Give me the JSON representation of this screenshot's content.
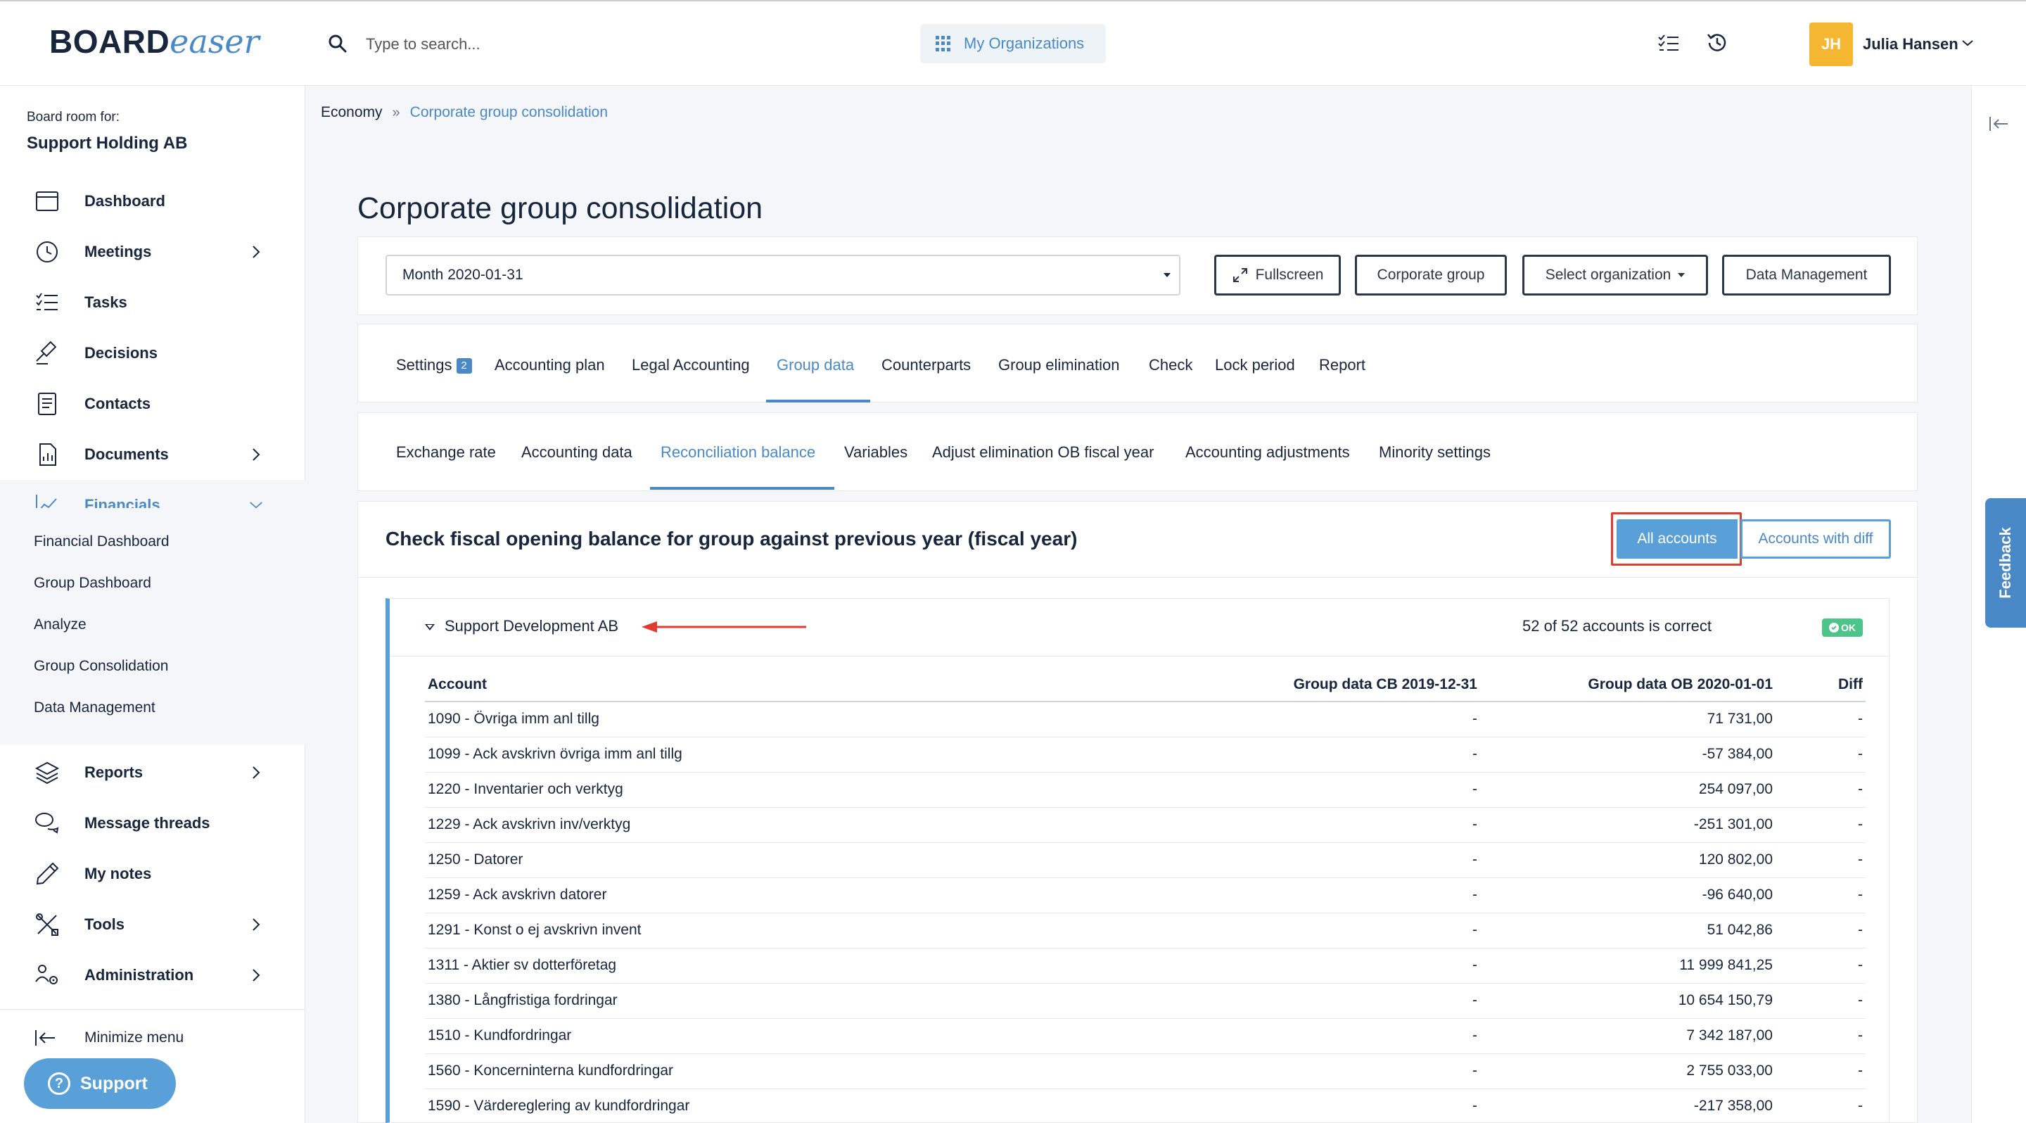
{
  "app": {
    "logo_main": "BOARD",
    "logo_accent": "easer",
    "search_placeholder": "Type to search...",
    "orgs_button": "My Organizations",
    "user_initials": "JH",
    "user_name": "Julia Hansen"
  },
  "sidebar": {
    "board_room_label": "Board room for:",
    "org_name": "Support Holding AB",
    "items": [
      {
        "label": "Dashboard"
      },
      {
        "label": "Meetings"
      },
      {
        "label": "Tasks"
      },
      {
        "label": "Decisions"
      },
      {
        "label": "Contacts"
      },
      {
        "label": "Documents"
      },
      {
        "label": "Financials"
      },
      {
        "label": "Reports"
      },
      {
        "label": "Message threads"
      },
      {
        "label": "My notes"
      },
      {
        "label": "Tools"
      },
      {
        "label": "Administration"
      }
    ],
    "financials_sub": [
      "Financial Dashboard",
      "Group Dashboard",
      "Analyze",
      "Group Consolidation",
      "Data Management"
    ],
    "minimize_label": "Minimize menu",
    "support_label": "Support"
  },
  "breadcrumb": {
    "parent": "Economy",
    "separator": "»",
    "current": "Corporate group consolidation"
  },
  "page": {
    "title": "Corporate group consolidation",
    "period": "Month 2020-01-31",
    "buttons": {
      "fullscreen": "Fullscreen",
      "corporate_group": "Corporate group",
      "select_org": "Select organization",
      "data_mgmt": "Data Management"
    }
  },
  "tabs": [
    {
      "label": "Settings",
      "badge": "2"
    },
    {
      "label": "Accounting plan"
    },
    {
      "label": "Legal Accounting"
    },
    {
      "label": "Group data"
    },
    {
      "label": "Counterparts"
    },
    {
      "label": "Group elimination"
    },
    {
      "label": "Check"
    },
    {
      "label": "Lock period"
    },
    {
      "label": "Report"
    }
  ],
  "subtabs": [
    {
      "label": "Exchange rate"
    },
    {
      "label": "Accounting data"
    },
    {
      "label": "Reconciliation balance"
    },
    {
      "label": "Variables"
    },
    {
      "label": "Adjust elimination OB fiscal year"
    },
    {
      "label": "Accounting adjustments"
    },
    {
      "label": "Minority settings"
    }
  ],
  "section": {
    "title": "Check fiscal opening balance for group against previous year (fiscal year)",
    "all_accounts": "All accounts",
    "accounts_with_diff": "Accounts with diff"
  },
  "company": {
    "name": "Support Development AB",
    "status": "52 of 52 accounts is correct",
    "ok_badge": "OK"
  },
  "table": {
    "headers": [
      "Account",
      "Group data CB 2019-12-31",
      "Group data OB 2020-01-01",
      "Diff"
    ],
    "rows": [
      [
        "1090 - Övriga imm anl tillg",
        "-",
        "71 731,00",
        "-"
      ],
      [
        "1099 - Ack avskrivn övriga imm anl tillg",
        "-",
        "-57 384,00",
        "-"
      ],
      [
        "1220 - Inventarier och verktyg",
        "-",
        "254 097,00",
        "-"
      ],
      [
        "1229 - Ack avskrivn inv/verktyg",
        "-",
        "-251 301,00",
        "-"
      ],
      [
        "1250 - Datorer",
        "-",
        "120 802,00",
        "-"
      ],
      [
        "1259 - Ack avskrivn datorer",
        "-",
        "-96 640,00",
        "-"
      ],
      [
        "1291 - Konst o ej avskrivn invent",
        "-",
        "51 042,86",
        "-"
      ],
      [
        "1311 - Aktier sv dotterföretag",
        "-",
        "11 999 841,25",
        "-"
      ],
      [
        "1380 - Långfristiga fordringar",
        "-",
        "10 654 150,79",
        "-"
      ],
      [
        "1510 - Kundfordringar",
        "-",
        "7 342 187,00",
        "-"
      ],
      [
        "1560 - Koncerninterna kundfordringar",
        "-",
        "2 755 033,00",
        "-"
      ],
      [
        "1590 - Värdereglering av kundfordringar",
        "-",
        "-217 358,00",
        "-"
      ]
    ]
  },
  "feedback_label": "Feedback",
  "colors": {
    "accent": "#4a89c8",
    "primary_btn": "#5aa0d8",
    "highlight": "#e03c31",
    "ok": "#4cc48a",
    "avatar": "#f5b731"
  }
}
